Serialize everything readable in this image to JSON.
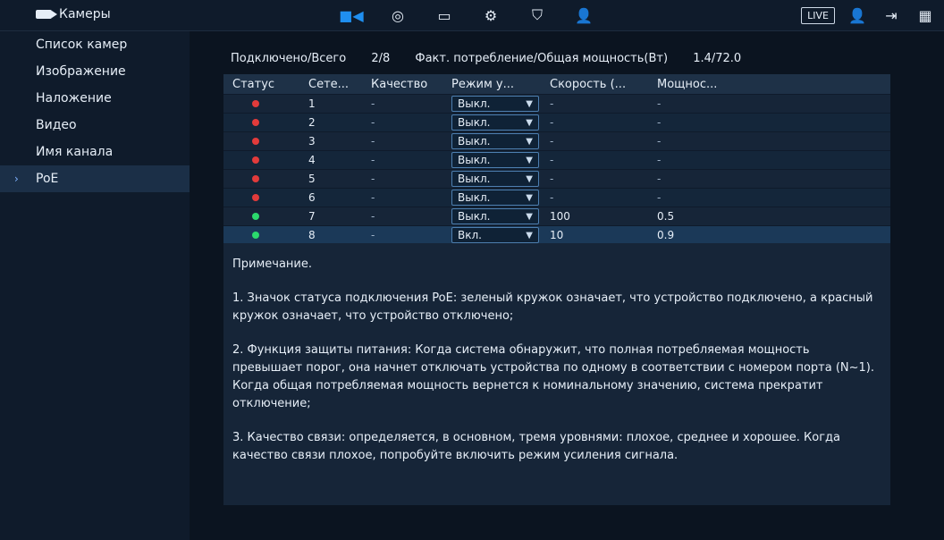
{
  "header": {
    "title": "Камеры",
    "live_label": "LIVE"
  },
  "sidebar": {
    "items": [
      {
        "label": "Список камер"
      },
      {
        "label": "Изображение"
      },
      {
        "label": "Наложение"
      },
      {
        "label": "Видео"
      },
      {
        "label": "Имя канала"
      },
      {
        "label": "PoE"
      }
    ]
  },
  "summary": {
    "connected_total_label": "Подключено/Всего",
    "connected_total_value": "2/8",
    "power_label": "Факт. потребление/Общая мощность(Вт)",
    "power_value": "1.4/72.0"
  },
  "table": {
    "headers": [
      "Статус",
      "Сете...",
      "Качество",
      "Режим у...",
      "Скорость (...",
      "Мощнос..."
    ],
    "rows": [
      {
        "status": "red",
        "net": "1",
        "quality": "-",
        "mode": "Выкл.",
        "speed": "-",
        "power": "-"
      },
      {
        "status": "red",
        "net": "2",
        "quality": "-",
        "mode": "Выкл.",
        "speed": "-",
        "power": "-"
      },
      {
        "status": "red",
        "net": "3",
        "quality": "-",
        "mode": "Выкл.",
        "speed": "-",
        "power": "-"
      },
      {
        "status": "red",
        "net": "4",
        "quality": "-",
        "mode": "Выкл.",
        "speed": "-",
        "power": "-"
      },
      {
        "status": "red",
        "net": "5",
        "quality": "-",
        "mode": "Выкл.",
        "speed": "-",
        "power": "-"
      },
      {
        "status": "red",
        "net": "6",
        "quality": "-",
        "mode": "Выкл.",
        "speed": "-",
        "power": "-"
      },
      {
        "status": "green",
        "net": "7",
        "quality": "-",
        "mode": "Выкл.",
        "speed": "100",
        "power": "0.5"
      },
      {
        "status": "green",
        "net": "8",
        "quality": "-",
        "mode": "Вкл.",
        "speed": "10",
        "power": "0.9"
      }
    ]
  },
  "note": {
    "title": "Примечание.",
    "p1": "1. Значок статуса подключения PoE: зеленый кружок означает, что устройство подключено, а красный кружок означает, что устройство отключено;",
    "p2": "2. Функция защиты питания: Когда система обнаружит, что полная потребляемая мощность превышает порог, она начнет отключать устройства по одному в соответствии с номером порта (N~1). Когда общая потребляемая мощность вернется к номинальному значению, система прекратит отключение;",
    "p3": "3. Качество связи: определяется, в основном, тремя уровнями: плохое, среднее и хорошее. Когда качество связи плохое, попробуйте включить режим усиления сигнала."
  }
}
